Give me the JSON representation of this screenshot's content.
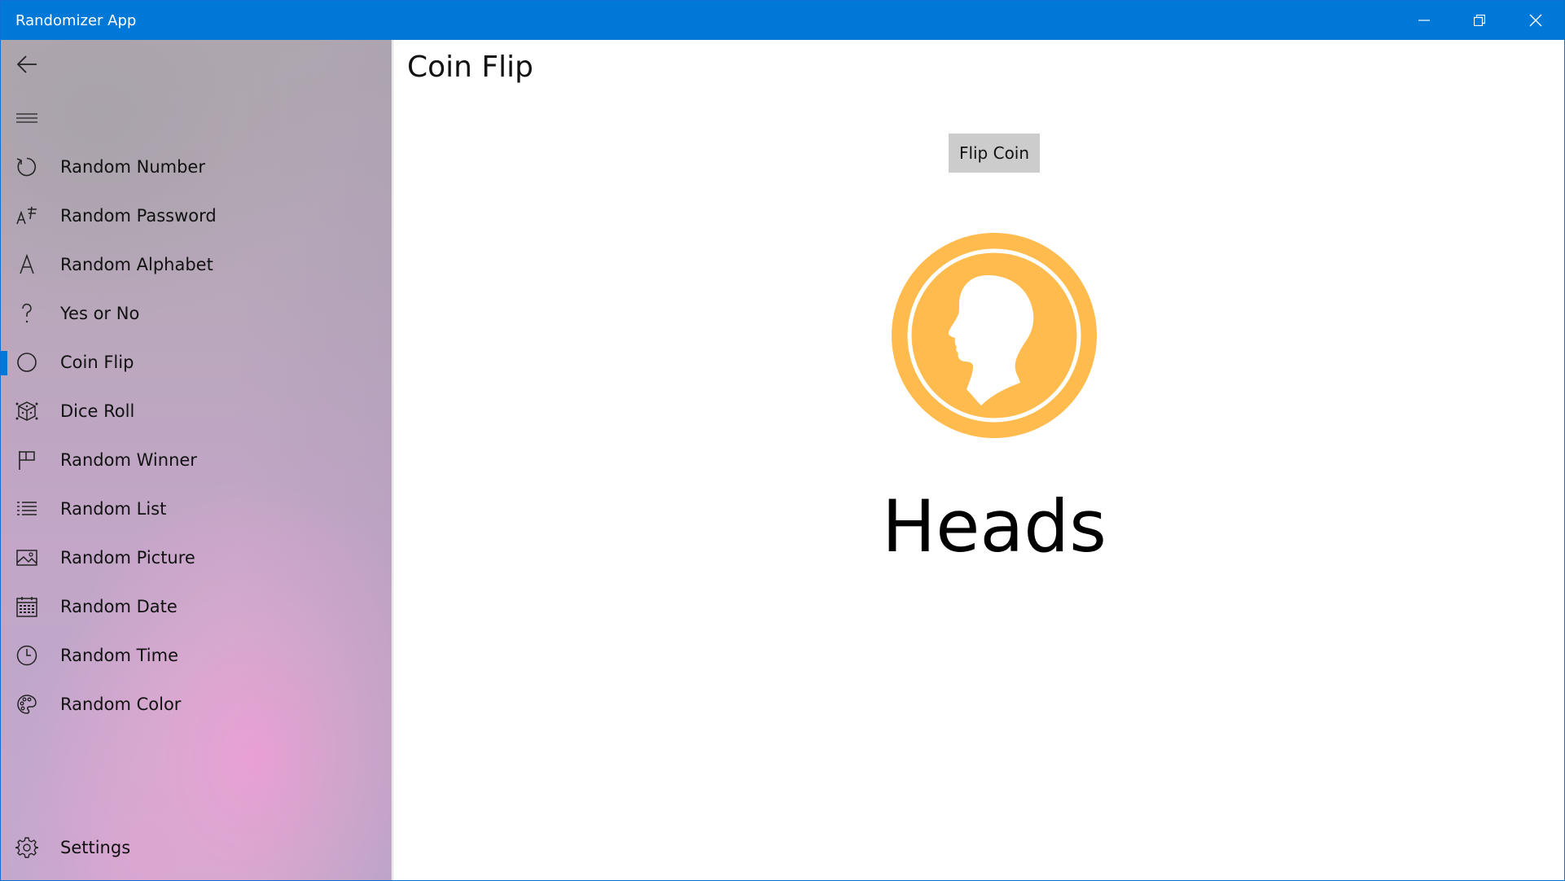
{
  "window": {
    "title": "Randomizer App"
  },
  "colors": {
    "titlebar": "#0078d7",
    "accent": "#0078d7",
    "coin": "#ffbb4d",
    "button": "#cccccc"
  },
  "sidebar": {
    "items": [
      {
        "label": "Random Number",
        "icon": "refresh-icon"
      },
      {
        "label": "Random Password",
        "icon": "password-icon"
      },
      {
        "label": "Random Alphabet",
        "icon": "letter-a-icon"
      },
      {
        "label": "Yes or No",
        "icon": "question-icon"
      },
      {
        "label": "Coin Flip",
        "icon": "circle-icon",
        "selected": true
      },
      {
        "label": "Dice Roll",
        "icon": "dice-icon"
      },
      {
        "label": "Random Winner",
        "icon": "flag-icon"
      },
      {
        "label": "Random List",
        "icon": "list-icon"
      },
      {
        "label": "Random Picture",
        "icon": "picture-icon"
      },
      {
        "label": "Random Date",
        "icon": "calendar-icon"
      },
      {
        "label": "Random Time",
        "icon": "clock-icon"
      },
      {
        "label": "Random Color",
        "icon": "palette-icon"
      }
    ],
    "settings_label": "Settings"
  },
  "main": {
    "title": "Coin Flip",
    "flip_button_label": "Flip Coin",
    "result": "Heads"
  }
}
